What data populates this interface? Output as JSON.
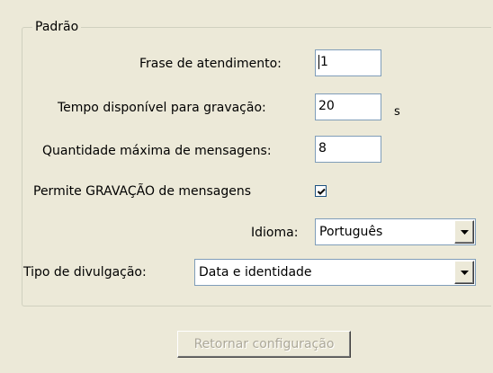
{
  "group": {
    "title": "Padrão"
  },
  "fields": {
    "frase": {
      "label": "Frase de atendimento:",
      "value": "1"
    },
    "tempo": {
      "label": "Tempo disponível para gravação:",
      "value": "20",
      "unit": "s"
    },
    "quantidade": {
      "label": "Quantidade máxima de mensagens:",
      "value": "8"
    },
    "permite": {
      "label": "Permite GRAVAÇÃO de mensagens",
      "checked": true
    },
    "idioma": {
      "label": "Idioma:",
      "value": "Português"
    },
    "divulgacao": {
      "label": "Tipo de divulgação:",
      "value": "Data e identidade"
    }
  },
  "buttons": {
    "retornar": {
      "label": "Retornar configuração",
      "enabled": false
    }
  },
  "icons": {
    "combo_arrow": "chevron-down-icon",
    "check": "check-icon"
  }
}
